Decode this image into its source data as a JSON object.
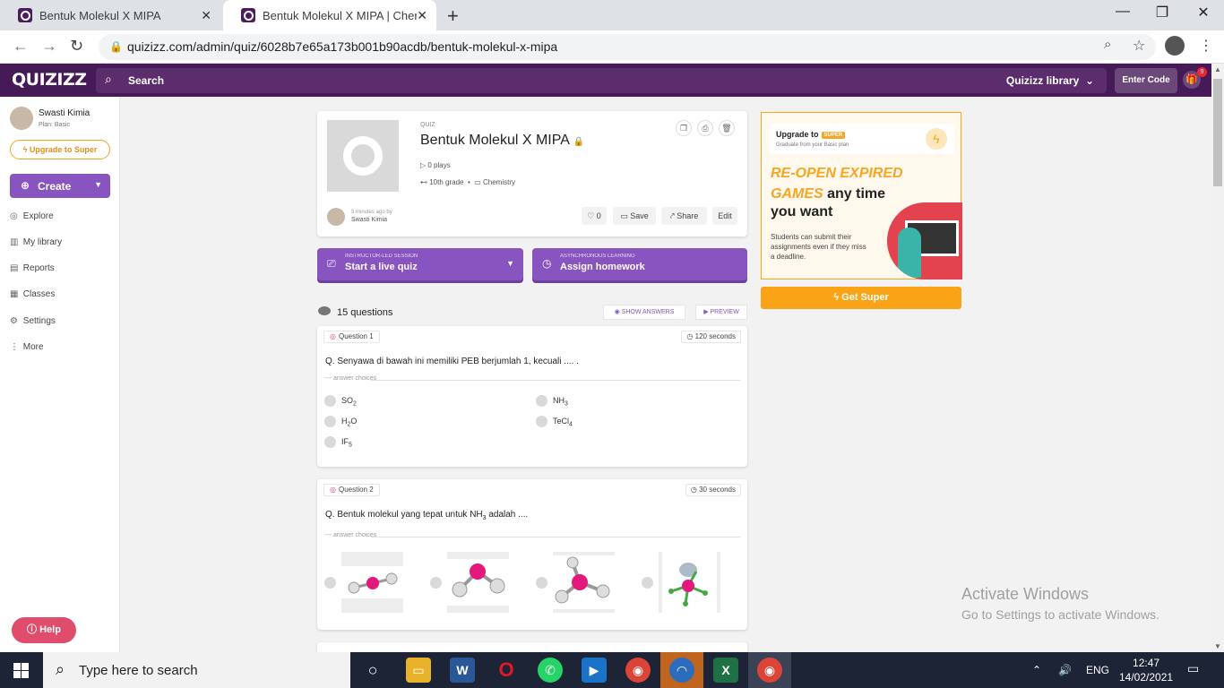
{
  "browser": {
    "tabs": [
      {
        "title": "Bentuk Molekul X MIPA",
        "active": false
      },
      {
        "title": "Bentuk Molekul X MIPA | Chemist",
        "active": true
      }
    ],
    "url": "quizizz.com/admin/quiz/6028b7e65a173b001b90acdb/bentuk-molekul-x-mipa"
  },
  "header": {
    "logo": "QUIZIZZ",
    "search_label": "Search",
    "library": "Quizizz library",
    "enter_code": "Enter Code",
    "gift_badge": "9"
  },
  "sidebar": {
    "user_name": "Swasti Kimia",
    "plan": "Plan: Basic",
    "upgrade": "Upgrade to Super",
    "create": "Create",
    "items": [
      {
        "label": "Explore",
        "icon": "compass-icon"
      },
      {
        "label": "My library",
        "icon": "library-icon"
      },
      {
        "label": "Reports",
        "icon": "chart-icon"
      },
      {
        "label": "Classes",
        "icon": "classes-icon"
      },
      {
        "label": "Settings",
        "icon": "gear-icon"
      },
      {
        "label": "More",
        "icon": "more-icon"
      }
    ],
    "help": "Help"
  },
  "quiz": {
    "type_label": "QUIZ",
    "title": "Bentuk Molekul X MIPA",
    "plays": "0 plays",
    "grade": "10th grade",
    "subject": "Chemistry",
    "author_time": "5 minutes ago by",
    "author": "Swasti Kimia",
    "likes": "0",
    "save": "Save",
    "share": "Share",
    "edit": "Edit"
  },
  "actions": {
    "live_sub": "INSTRUCTOR-LED SESSION",
    "live_main": "Start a live quiz",
    "hw_sub": "ASYNCHRONOUS LEARNING",
    "hw_main": "Assign homework"
  },
  "questions_header": {
    "count": "15 questions",
    "show_answers": "SHOW ANSWERS",
    "preview": "PREVIEW"
  },
  "questions": [
    {
      "number": "Question 1",
      "seconds": "120 seconds",
      "text": "Q. Senyawa di bawah ini memiliki PEB berjumlah 1, kecuali .... .",
      "choices_label": "answer choices"
    },
    {
      "number": "Question 2",
      "seconds": "30 seconds",
      "text_before": "Q. Bentuk molekul yang tepat untuk NH",
      "text_sub": "3",
      "text_after": " adalah ....",
      "choices_label": "answer choices"
    }
  ],
  "ad": {
    "upgrade_to": "Upgrade to",
    "super": "SUPER",
    "graduate": "Graduate from your Basic plan",
    "h1a": "RE-OPEN EXPIRED",
    "h1b": "GAMES",
    "h1c": "any time",
    "h2": "you want",
    "body": "Students can submit their assignments even if they miss a deadline.",
    "cta": "Get Super"
  },
  "watermark": {
    "line1": "Activate Windows",
    "line2": "Go to Settings to activate Windows."
  },
  "taskbar": {
    "search": "Type here to search",
    "lang": "ENG",
    "time": "12:47",
    "date": "14/02/2021",
    "notif": "1"
  }
}
